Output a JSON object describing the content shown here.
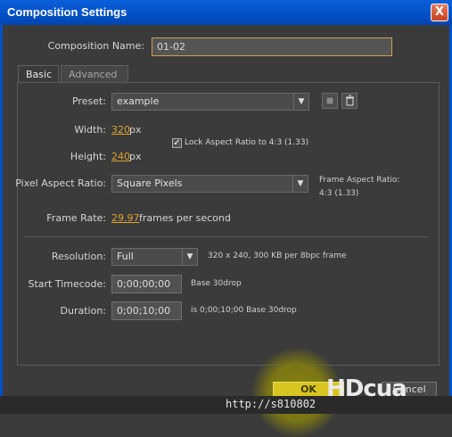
{
  "window": {
    "title": "Composition Settings",
    "close_glyph": "X"
  },
  "comp_name": {
    "label": "Composition Name:",
    "value": "01-02"
  },
  "tabs": [
    {
      "label": "Basic"
    },
    {
      "label": "Advanced"
    }
  ],
  "preset": {
    "label": "Preset:",
    "value": "example"
  },
  "width": {
    "label": "Width:",
    "value": "320",
    "unit": "px"
  },
  "height": {
    "label": "Height:",
    "value": "240",
    "unit": "px"
  },
  "lock_aspect": {
    "checked": true,
    "label": "Lock Aspect Ratio to 4:3 (1.33)"
  },
  "pixel_aspect": {
    "label": "Pixel Aspect Ratio:",
    "value": "Square Pixels"
  },
  "frame_aspect": {
    "title": "Frame Aspect Ratio:",
    "value": "4:3 (1.33)"
  },
  "frame_rate": {
    "label": "Frame Rate:",
    "value": "29.97",
    "suffix": "frames per second"
  },
  "resolution": {
    "label": "Resolution:",
    "value": "Full",
    "info": "320 x 240, 300 KB per 8bpc frame"
  },
  "start_timecode": {
    "label": "Start Timecode:",
    "value": "0;00;00;00",
    "base": "Base 30drop"
  },
  "duration": {
    "label": "Duration:",
    "value": "0;00;10;00",
    "info": "is 0;00;10;00  Base 30drop"
  },
  "buttons": {
    "ok": "OK",
    "cancel": "Cancel"
  },
  "watermark": {
    "text": "HDcua"
  },
  "url": "http://s810802"
}
